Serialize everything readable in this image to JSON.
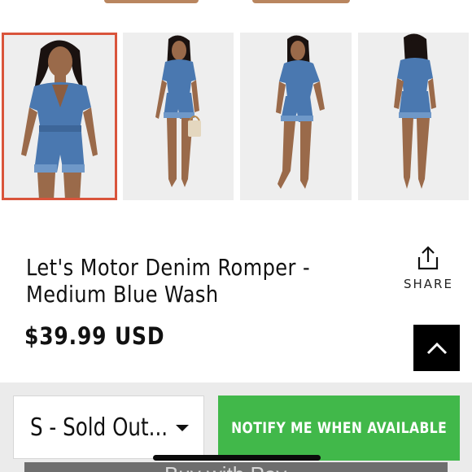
{
  "product": {
    "title_line1": "Let's Motor Denim Romper -",
    "title_line2": "Medium Blue Wash",
    "price": "$39.99 USD"
  },
  "gallery": {
    "thumbnails": [
      {
        "view": "front-close",
        "selected": true
      },
      {
        "view": "front-with-bag",
        "selected": false
      },
      {
        "view": "three-quarter",
        "selected": false
      },
      {
        "view": "back",
        "selected": false
      }
    ]
  },
  "actions": {
    "share_label": "SHARE",
    "share_icon": "share-icon",
    "scroll_top_icon": "chevron-up-icon"
  },
  "purchase": {
    "size_selected": "S - Sold Out...",
    "notify_label": "NOTIFY ME WHEN AVAILABLE",
    "applepay_label": "Buy with  Pay"
  },
  "colors": {
    "selected_outline": "#d9543b",
    "notify_button": "#41b84a",
    "denim": "#4a78b0",
    "skin": "#9a6a4a"
  }
}
